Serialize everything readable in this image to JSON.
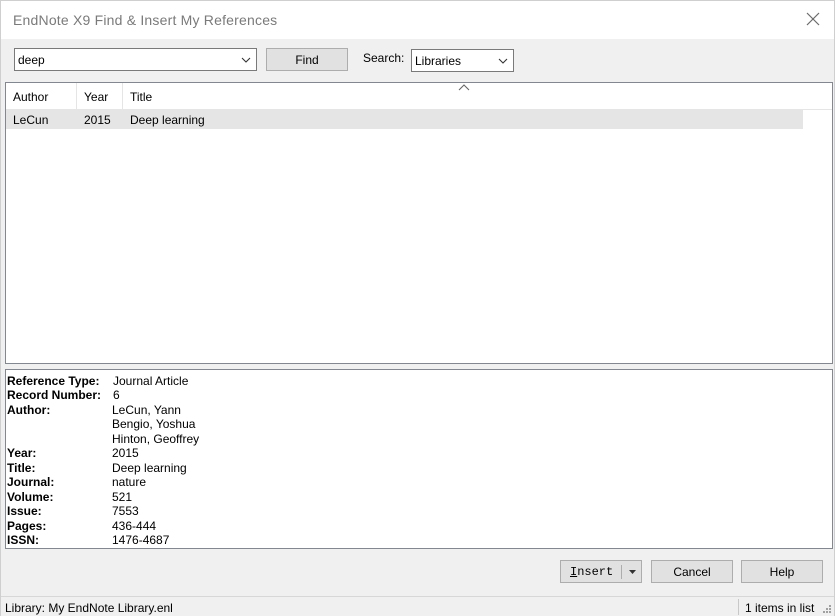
{
  "window": {
    "title": "EndNote X9 Find & Insert My References"
  },
  "search": {
    "query": "deep",
    "find_label": "Find",
    "search_label": "Search:",
    "scope_value": "Libraries"
  },
  "list": {
    "columns": [
      "Author",
      "Year",
      "Title"
    ],
    "rows": [
      {
        "author": "LeCun",
        "year": "2015",
        "title": "Deep learning"
      }
    ]
  },
  "details": {
    "fields": [
      {
        "label": "Reference Type:",
        "value": "Journal Article"
      },
      {
        "label": "Record Number:",
        "value": "6"
      },
      {
        "label": "Author:",
        "values": [
          "LeCun, Yann",
          "Bengio, Yoshua",
          "Hinton, Geoffrey"
        ]
      },
      {
        "label": "Year:",
        "value": "2015"
      },
      {
        "label": "Title:",
        "value": "Deep learning"
      },
      {
        "label": "Journal:",
        "value": "nature"
      },
      {
        "label": "Volume:",
        "value": "521"
      },
      {
        "label": "Issue:",
        "value": "7553"
      },
      {
        "label": "Pages:",
        "value": "436-444"
      },
      {
        "label": "ISSN:",
        "value": "1476-4687"
      }
    ]
  },
  "buttons": {
    "insert_label_mnemonic": "I",
    "insert_label_rest": "nsert",
    "cancel_label": "Cancel",
    "help_label": "Help"
  },
  "status": {
    "library": "Library: My EndNote Library.enl",
    "count": "1 items in list"
  },
  "icons": {
    "close": "close-icon",
    "dropdown": "chevron-down-icon",
    "sort": "sort-ascending-icon",
    "grip": "resize-grip-icon"
  }
}
